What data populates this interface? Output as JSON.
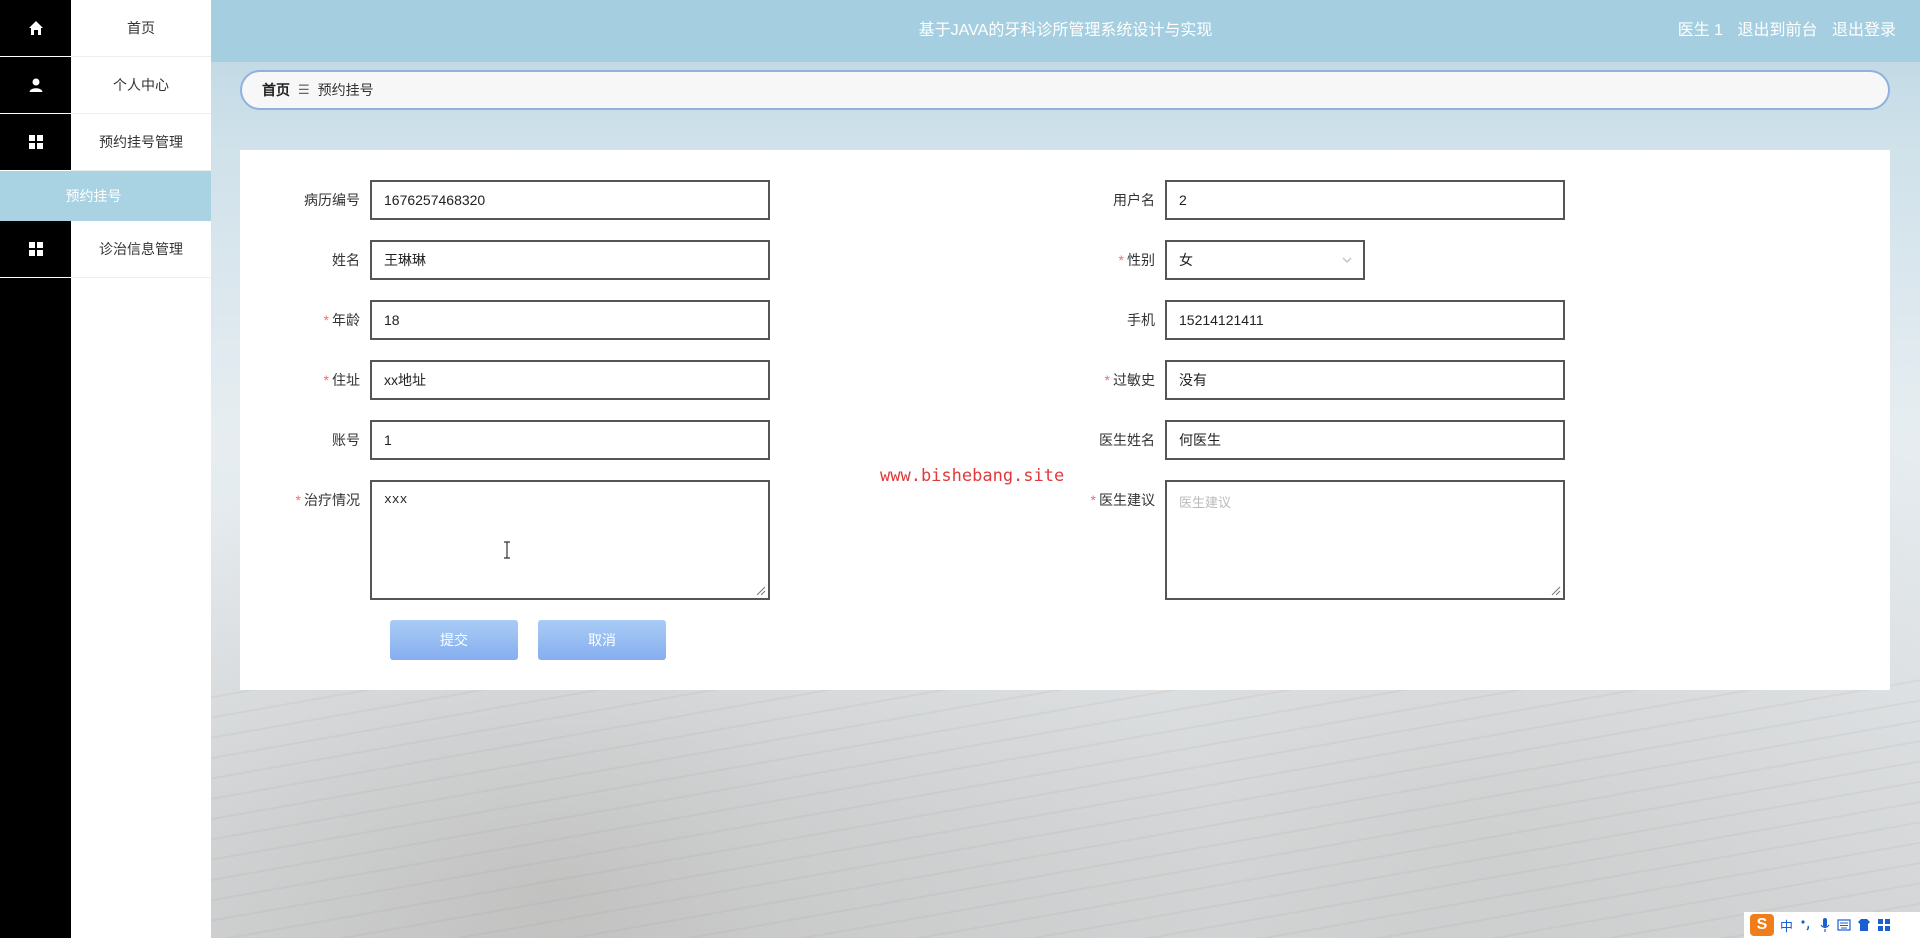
{
  "app": {
    "title": "基于JAVA的牙科诊所管理系统设计与实现"
  },
  "header": {
    "user_label": "医生 1",
    "front_link": "退出到前台",
    "logout_link": "退出登录"
  },
  "sidebar": {
    "items": [
      {
        "label": "首页",
        "icon": "home-icon"
      },
      {
        "label": "个人中心",
        "icon": "user-icon"
      },
      {
        "label": "预约挂号管理",
        "icon": "grid-icon"
      },
      {
        "label": "诊治信息管理",
        "icon": "grid-icon"
      }
    ],
    "active_sub": "预约挂号"
  },
  "breadcrumb": {
    "home": "首页",
    "separator": "☰",
    "current": "预约挂号"
  },
  "form": {
    "record_no": {
      "label": "病历编号",
      "value": "1676257468320"
    },
    "username": {
      "label": "用户名",
      "value": "2"
    },
    "name": {
      "label": "姓名",
      "value": "王琳琳"
    },
    "gender": {
      "label": "性别",
      "value": "女",
      "required_mark": "*"
    },
    "age": {
      "label": "年龄",
      "value": "18",
      "required_mark": "*"
    },
    "phone": {
      "label": "手机",
      "value": "15214121411"
    },
    "address": {
      "label": "住址",
      "value": "xx地址",
      "required_mark": "*"
    },
    "allergy": {
      "label": "过敏史",
      "value": "没有",
      "required_mark": "*"
    },
    "account": {
      "label": "账号",
      "value": "1"
    },
    "doctor_name": {
      "label": "医生姓名",
      "value": "何医生"
    },
    "treatment": {
      "label": "治疗情况",
      "value": "xxx",
      "required_mark": "*"
    },
    "advice": {
      "label": "医生建议",
      "placeholder": "医生建议",
      "required_mark": "*"
    },
    "submit_label": "提交",
    "cancel_label": "取消"
  },
  "watermark": "www.bishebang.site",
  "ime": {
    "logo": "S",
    "mode": "中"
  },
  "colors": {
    "header_bg": "#a5cfe0",
    "active_menu_bg": "#a9d2e2",
    "required": "#f56c6c",
    "button": "#86aef0",
    "watermark": "#e03a3a"
  }
}
